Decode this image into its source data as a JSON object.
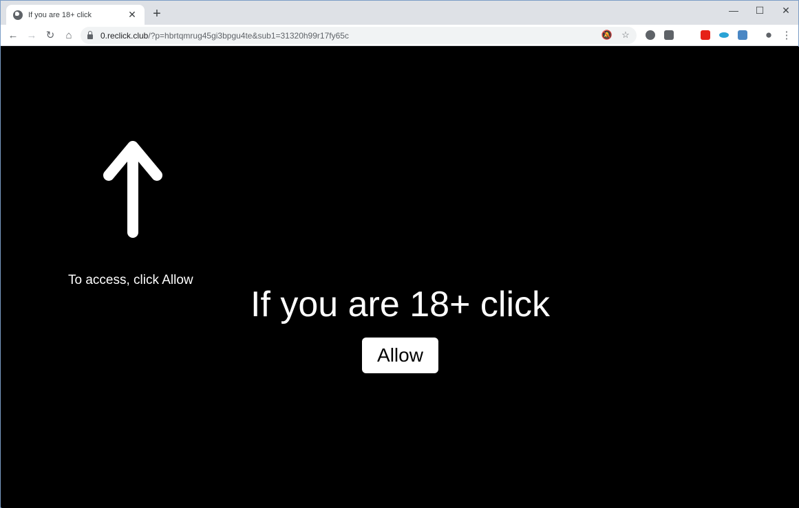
{
  "browser": {
    "tab": {
      "title": "If you are 18+ click",
      "favicon": "globe-icon",
      "close": "✕"
    },
    "new_tab": "+",
    "window_controls": {
      "minimize": "—",
      "maximize": "☐",
      "close": "✕"
    },
    "nav": {
      "back": "←",
      "forward": "→",
      "reload": "↻",
      "home": "⌂"
    },
    "url": {
      "host": "0.reclick.club",
      "path": "/?p=hbrtqmrug45gi3bpgu4te&sub1=31320h99r17fy65c"
    },
    "omnibox_icons": {
      "notifications_blocked": "🔕",
      "bookmark": "☆"
    },
    "extensions": [
      {
        "name": "extension-1",
        "color": "#5f6368"
      },
      {
        "name": "extension-2",
        "color": "#5f6368"
      },
      {
        "name": "extension-youtube",
        "color": "#e62117"
      },
      {
        "name": "extension-4",
        "color": "#29a3d6"
      },
      {
        "name": "extension-5",
        "color": "#4a87c4"
      }
    ],
    "profile": "●",
    "menu": "⋮"
  },
  "page": {
    "hint": "To access, click Allow",
    "headline": "If you are 18+ click",
    "button": "Allow",
    "background": "#000000",
    "foreground": "#ffffff"
  }
}
